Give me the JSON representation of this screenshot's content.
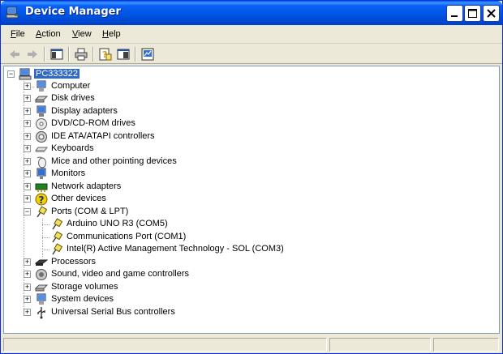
{
  "window": {
    "title": "Device Manager",
    "icon": "device-manager-icon"
  },
  "title_buttons": {
    "minimize": "_",
    "maximize": "□",
    "close": "X"
  },
  "menu": [
    {
      "label": "File",
      "underline": "F",
      "rest": "ile"
    },
    {
      "label": "Action",
      "underline": "A",
      "rest": "ction"
    },
    {
      "label": "View",
      "underline": "V",
      "rest": "iew"
    },
    {
      "label": "Help",
      "underline": "H",
      "rest": "elp"
    }
  ],
  "toolbar": {
    "buttons": [
      "back-icon",
      "forward-icon",
      "show-hide-tree-icon",
      "print-icon",
      "properties-help-icon",
      "export-list-icon",
      "scan-hardware-icon"
    ]
  },
  "tree": {
    "root": {
      "label": "PC333322",
      "icon": "computer-icon",
      "expanded": true,
      "selected": true
    },
    "items": [
      {
        "label": "Computer",
        "icon": "computer-icon"
      },
      {
        "label": "Disk drives",
        "icon": "disk-drive-icon"
      },
      {
        "label": "Display adapters",
        "icon": "display-adapter-icon"
      },
      {
        "label": "DVD/CD-ROM drives",
        "icon": "cdrom-icon"
      },
      {
        "label": "IDE ATA/ATAPI controllers",
        "icon": "ide-controller-icon"
      },
      {
        "label": "Keyboards",
        "icon": "keyboard-icon"
      },
      {
        "label": "Mice and other pointing devices",
        "icon": "mouse-icon"
      },
      {
        "label": "Monitors",
        "icon": "monitor-icon"
      },
      {
        "label": "Network adapters",
        "icon": "network-adapter-icon"
      },
      {
        "label": "Other devices",
        "icon": "unknown-device-icon"
      },
      {
        "label": "Ports (COM & LPT)",
        "icon": "port-icon",
        "expanded": true,
        "children": [
          {
            "label": "Arduino UNO R3 (COM5)",
            "icon": "port-icon"
          },
          {
            "label": "Communications Port (COM1)",
            "icon": "port-icon"
          },
          {
            "label": "Intel(R) Active Management Technology - SOL (COM3)",
            "icon": "port-icon"
          }
        ]
      },
      {
        "label": "Processors",
        "icon": "processor-icon"
      },
      {
        "label": "Sound, video and game controllers",
        "icon": "sound-icon"
      },
      {
        "label": "Storage volumes",
        "icon": "storage-volume-icon"
      },
      {
        "label": "System devices",
        "icon": "system-device-icon"
      },
      {
        "label": "Universal Serial Bus controllers",
        "icon": "usb-icon"
      }
    ]
  },
  "colors": {
    "titlebar": "#0054e3",
    "selection": "#316ac5",
    "window_bg": "#ece9d8"
  }
}
